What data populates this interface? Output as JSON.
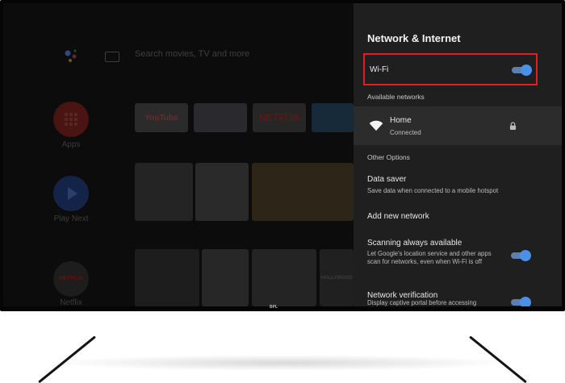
{
  "home": {
    "search_placeholder": "Search movies, TV and more",
    "apps": [
      {
        "label": "Apps"
      },
      {
        "label": "Play Next"
      },
      {
        "label": "Netflix",
        "badge": "NETFLIX"
      }
    ],
    "tiles": {
      "youtube": "YouTube",
      "netflix": "NETFLIX",
      "hollywood": "HOLLYWOOD"
    }
  },
  "panel": {
    "title": "Network & Internet",
    "wifi_label": "Wi-Fi",
    "wifi_on": true,
    "available_networks_header": "Available networks",
    "network": {
      "name": "Home",
      "status": "Connected"
    },
    "other_options_header": "Other Options",
    "options": [
      {
        "title": "Data saver",
        "subtitle": "Save data when connected to a mobile hotspot"
      },
      {
        "title": "Add new network"
      },
      {
        "title": "Scanning always available",
        "subtitle": "Let Google's location service and other apps scan for networks, even when Wi-Fi is off",
        "toggle_on": true
      },
      {
        "title": "Network verification",
        "subtitle": "Display captive portal before accessing",
        "toggle_on": true
      }
    ]
  },
  "brand": "BPL",
  "colors": {
    "highlight": "#e01e24",
    "toggle_knob": "#4a90e8",
    "panel_bg": "#1f1f1f"
  }
}
